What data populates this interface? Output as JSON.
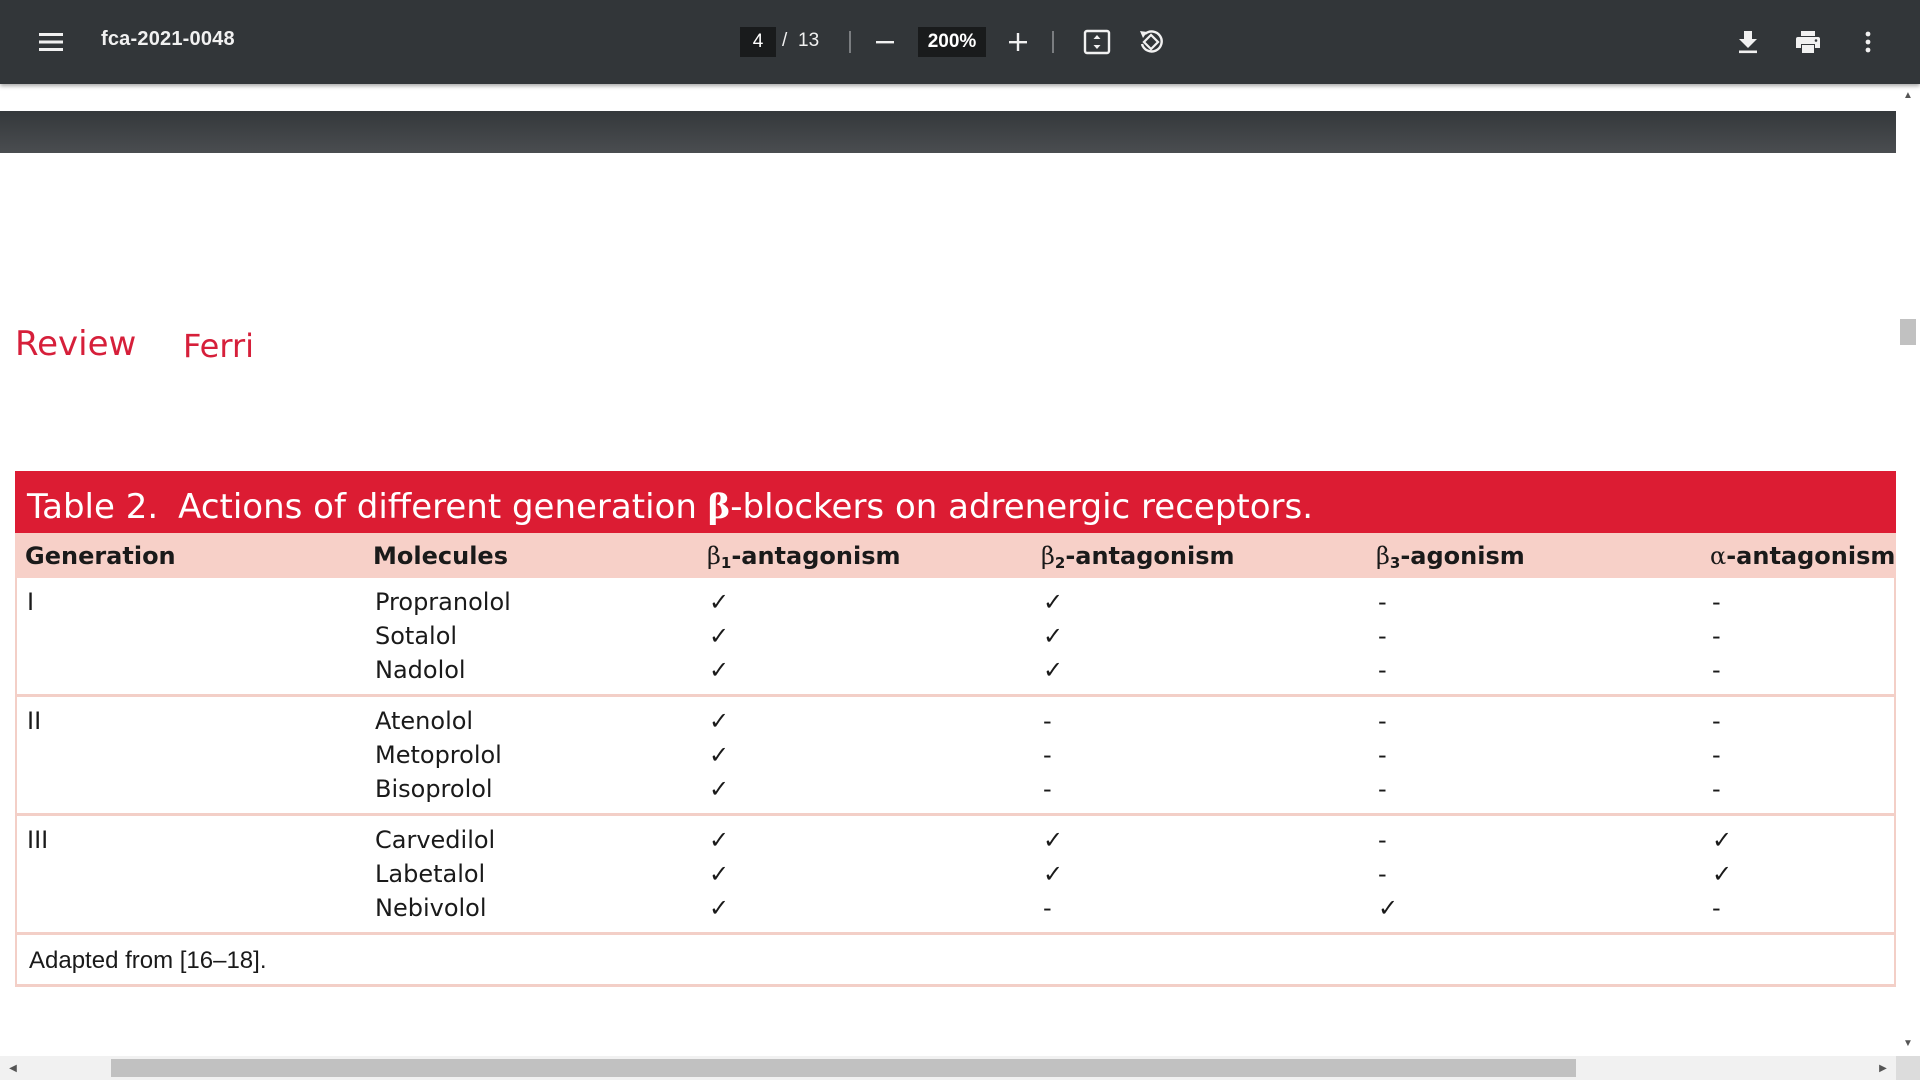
{
  "toolbar": {
    "title": "fca-2021-0048",
    "page_current": "4",
    "page_separator": "/",
    "page_total": "13",
    "zoom_value": "200%",
    "icons": {
      "menu": "menu-icon",
      "zoom_out": "minus-icon",
      "zoom_in": "plus-icon",
      "fit": "fit-to-page-icon",
      "rotate": "rotate-icon",
      "download": "download-icon",
      "print": "print-icon",
      "more": "more-vert-icon"
    }
  },
  "page": {
    "running_head": {
      "section": "Review",
      "author": "Ferri"
    },
    "table": {
      "label": "Table 2.",
      "title_prefix": "Actions of different generation ",
      "title_beta": "β",
      "title_suffix": "-blockers on adrenergic receptors.",
      "headers": {
        "generation": "Generation",
        "molecules": "Molecules",
        "b1_symbol": "β",
        "b1_sub": "1",
        "b1_text": "-antagonism",
        "b2_symbol": "β",
        "b2_sub": "2",
        "b2_text": "-antagonism",
        "b3_symbol": "β",
        "b3_sub": "3",
        "b3_text": "-agonism",
        "alpha_symbol": "α",
        "alpha_text": "-antagonism"
      },
      "groups": [
        {
          "generation": "I",
          "rows": [
            {
              "molecule": "Propranolol",
              "b1": "✓",
              "b2": "✓",
              "b3": "-",
              "alpha": "-"
            },
            {
              "molecule": "Sotalol",
              "b1": "✓",
              "b2": "✓",
              "b3": "-",
              "alpha": "-"
            },
            {
              "molecule": "Nadolol",
              "b1": "✓",
              "b2": "✓",
              "b3": "-",
              "alpha": "-"
            }
          ]
        },
        {
          "generation": "II",
          "rows": [
            {
              "molecule": "Atenolol",
              "b1": "✓",
              "b2": "-",
              "b3": "-",
              "alpha": "-"
            },
            {
              "molecule": "Metoprolol",
              "b1": "✓",
              "b2": "-",
              "b3": "-",
              "alpha": "-"
            },
            {
              "molecule": "Bisoprolol",
              "b1": "✓",
              "b2": "-",
              "b3": "-",
              "alpha": "-"
            }
          ]
        },
        {
          "generation": "III",
          "rows": [
            {
              "molecule": "Carvedilol",
              "b1": "✓",
              "b2": "✓",
              "b3": "-",
              "alpha": "✓"
            },
            {
              "molecule": "Labetalol",
              "b1": "✓",
              "b2": "✓",
              "b3": "-",
              "alpha": "✓"
            },
            {
              "molecule": "Nebivolol",
              "b1": "✓",
              "b2": "-",
              "b3": "✓",
              "alpha": "-"
            }
          ]
        }
      ],
      "footnote": "Adapted from [16–18]."
    }
  },
  "colors": {
    "toolbar_bg": "#323639",
    "accent_red": "#dc1c33",
    "header_row_bg": "#f7d0c8",
    "rule": "#f3cfc7"
  }
}
